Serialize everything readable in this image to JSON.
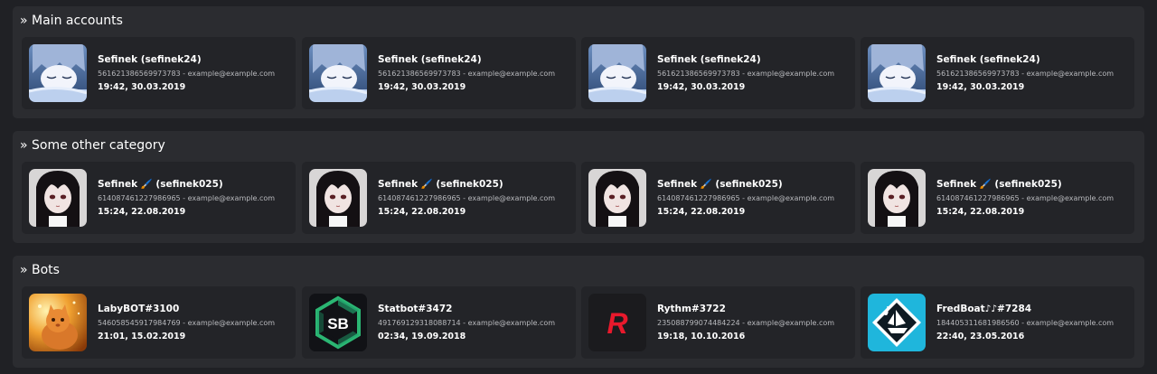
{
  "sections": [
    {
      "title": "» Main accounts",
      "cards": [
        {
          "name": "Sefinek (sefinek24)",
          "meta": "561621386569973783 - example@example.com",
          "date": "19:42, 30.03.2019",
          "avatar": "sleeping-anime-avatar"
        },
        {
          "name": "Sefinek (sefinek24)",
          "meta": "561621386569973783 - example@example.com",
          "date": "19:42, 30.03.2019",
          "avatar": "sleeping-anime-avatar"
        },
        {
          "name": "Sefinek (sefinek24)",
          "meta": "561621386569973783 - example@example.com",
          "date": "19:42, 30.03.2019",
          "avatar": "sleeping-anime-avatar"
        },
        {
          "name": "Sefinek (sefinek24)",
          "meta": "561621386569973783 - example@example.com",
          "date": "19:42, 30.03.2019",
          "avatar": "sleeping-anime-avatar"
        }
      ]
    },
    {
      "title": "» Some other category",
      "cards": [
        {
          "name": "Sefinek 🖌️ (sefinek025)",
          "meta": "614087461227986965 - example@example.com",
          "date": "15:24, 22.08.2019",
          "avatar": "dark-hair-anime-avatar"
        },
        {
          "name": "Sefinek 🖌️ (sefinek025)",
          "meta": "614087461227986965 - example@example.com",
          "date": "15:24, 22.08.2019",
          "avatar": "dark-hair-anime-avatar"
        },
        {
          "name": "Sefinek 🖌️ (sefinek025)",
          "meta": "614087461227986965 - example@example.com",
          "date": "15:24, 22.08.2019",
          "avatar": "dark-hair-anime-avatar"
        },
        {
          "name": "Sefinek 🖌️ (sefinek025)",
          "meta": "614087461227986965 - example@example.com",
          "date": "15:24, 22.08.2019",
          "avatar": "dark-hair-anime-avatar"
        }
      ]
    },
    {
      "title": "» Bots",
      "cards": [
        {
          "name": "LabyBOT#3100",
          "meta": "546058545917984769 - example@example.com",
          "date": "21:01, 15.02.2019",
          "avatar": "cat-avatar"
        },
        {
          "name": "Statbot#3472",
          "meta": "491769129318088714 - example@example.com",
          "date": "02:34, 19.09.2018",
          "avatar": "statbot-logo",
          "logo_text": "SB"
        },
        {
          "name": "Rythm#3722",
          "meta": "235088799074484224 - example@example.com",
          "date": "19:18, 10.10.2016",
          "avatar": "rythm-logo",
          "logo_text": "R"
        },
        {
          "name": "FredBoat♪♪#7284",
          "meta": "184405311681986560 - example@example.com",
          "date": "22:40, 23.05.2016",
          "avatar": "fredboat-logo"
        }
      ]
    }
  ],
  "colors": {
    "page_bg": "#202125",
    "section_bg": "#2b2c30",
    "card_bg": "#232428",
    "meta_text": "#b8b9bd",
    "rythm_red": "#e8192c",
    "fredboat_blue": "#1fb6dc",
    "statbot_green": "#2bb673"
  }
}
